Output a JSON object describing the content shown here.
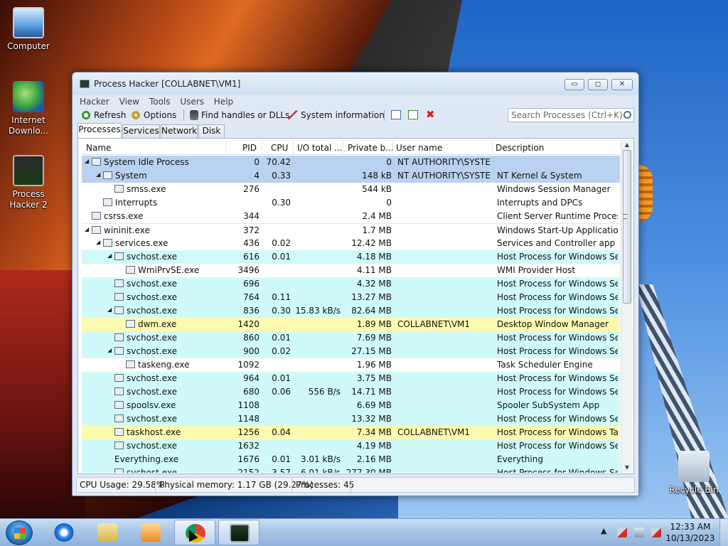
{
  "desktop": {
    "icons": [
      {
        "label": "Computer"
      },
      {
        "label": "Internet Downlo..."
      },
      {
        "label": "Process Hacker 2"
      },
      {
        "label": "Recycle Bin"
      }
    ]
  },
  "window": {
    "title": "Process Hacker [COLLABNET\\VM1]",
    "controls": {
      "minimize": "▭",
      "maximize": "◻",
      "close": "✕"
    },
    "menu": [
      "Hacker",
      "View",
      "Tools",
      "Users",
      "Help"
    ],
    "toolbar": {
      "refresh": "Refresh",
      "options": "Options",
      "find_handles": "Find handles or DLLs",
      "system_information": "System information",
      "search_placeholder": "Search Processes (Ctrl+K)"
    },
    "tabs": [
      "Processes",
      "Services",
      "Network",
      "Disk"
    ],
    "columns": [
      "Name",
      "PID",
      "CPU",
      "I/O total ...",
      "Private b...",
      "User name",
      "Description"
    ],
    "rows": [
      {
        "name": "System Idle Process",
        "pid": "0",
        "cpu": "70.42",
        "io": "",
        "priv": "0",
        "user": "NT AUTHORITY\\SYSTEM",
        "desc": "",
        "indent": 0,
        "expand": true,
        "kind": "sel"
      },
      {
        "name": "System",
        "pid": "4",
        "cpu": "0.33",
        "io": "",
        "priv": "148 kB",
        "user": "NT AUTHORITY\\SYSTEM",
        "desc": "NT Kernel & System",
        "indent": 1,
        "expand": true,
        "kind": "sel"
      },
      {
        "name": "smss.exe",
        "pid": "276",
        "cpu": "",
        "io": "",
        "priv": "544 kB",
        "user": "",
        "desc": "Windows Session Manager",
        "indent": 2,
        "expand": false,
        "kind": "plain"
      },
      {
        "name": "Interrupts",
        "pid": "",
        "cpu": "0.30",
        "io": "",
        "priv": "0",
        "user": "",
        "desc": "Interrupts and DPCs",
        "indent": 1,
        "expand": false,
        "kind": "plain"
      },
      {
        "name": "csrss.exe",
        "pid": "344",
        "cpu": "",
        "io": "",
        "priv": "2.4 MB",
        "user": "",
        "desc": "Client Server Runtime Process",
        "indent": 0,
        "expand": false,
        "kind": "plain"
      },
      {
        "name": "wininit.exe",
        "pid": "372",
        "cpu": "",
        "io": "",
        "priv": "1.7 MB",
        "user": "",
        "desc": "Windows Start-Up Application",
        "indent": 0,
        "expand": true,
        "kind": "hot"
      },
      {
        "name": "services.exe",
        "pid": "436",
        "cpu": "0.02",
        "io": "",
        "priv": "12.42 MB",
        "user": "",
        "desc": "Services and Controller app",
        "indent": 1,
        "expand": true,
        "kind": "plain"
      },
      {
        "name": "svchost.exe",
        "pid": "616",
        "cpu": "0.01",
        "io": "",
        "priv": "4.18 MB",
        "user": "",
        "desc": "Host Process for Windows Ser...",
        "indent": 2,
        "expand": true,
        "kind": "svc"
      },
      {
        "name": "WmiPrvSE.exe",
        "pid": "3496",
        "cpu": "",
        "io": "",
        "priv": "4.11 MB",
        "user": "",
        "desc": "WMI Provider Host",
        "indent": 3,
        "expand": false,
        "kind": "plain"
      },
      {
        "name": "svchost.exe",
        "pid": "696",
        "cpu": "",
        "io": "",
        "priv": "4.32 MB",
        "user": "",
        "desc": "Host Process for Windows Ser...",
        "indent": 2,
        "expand": false,
        "kind": "svc"
      },
      {
        "name": "svchost.exe",
        "pid": "764",
        "cpu": "0.11",
        "io": "",
        "priv": "13.27 MB",
        "user": "",
        "desc": "Host Process for Windows Ser...",
        "indent": 2,
        "expand": false,
        "kind": "svc"
      },
      {
        "name": "svchost.exe",
        "pid": "836",
        "cpu": "0.30",
        "io": "15.83 kB/s",
        "priv": "82.64 MB",
        "user": "",
        "desc": "Host Process for Windows Ser...",
        "indent": 2,
        "expand": true,
        "kind": "svc"
      },
      {
        "name": "dwm.exe",
        "pid": "1420",
        "cpu": "",
        "io": "",
        "priv": "1.89 MB",
        "user": "COLLABNET\\VM1",
        "desc": "Desktop Window Manager",
        "indent": 3,
        "expand": false,
        "kind": "own"
      },
      {
        "name": "svchost.exe",
        "pid": "860",
        "cpu": "0.01",
        "io": "",
        "priv": "7.69 MB",
        "user": "",
        "desc": "Host Process for Windows Ser...",
        "indent": 2,
        "expand": false,
        "kind": "svc"
      },
      {
        "name": "svchost.exe",
        "pid": "900",
        "cpu": "0.02",
        "io": "",
        "priv": "27.15 MB",
        "user": "",
        "desc": "Host Process for Windows Ser...",
        "indent": 2,
        "expand": true,
        "kind": "svc"
      },
      {
        "name": "taskeng.exe",
        "pid": "1092",
        "cpu": "",
        "io": "",
        "priv": "1.96 MB",
        "user": "",
        "desc": "Task Scheduler Engine",
        "indent": 3,
        "expand": false,
        "kind": "plain"
      },
      {
        "name": "svchost.exe",
        "pid": "964",
        "cpu": "0.01",
        "io": "",
        "priv": "3.75 MB",
        "user": "",
        "desc": "Host Process for Windows Ser...",
        "indent": 2,
        "expand": false,
        "kind": "svc"
      },
      {
        "name": "svchost.exe",
        "pid": "680",
        "cpu": "0.06",
        "io": "556 B/s",
        "priv": "14.71 MB",
        "user": "",
        "desc": "Host Process for Windows Ser...",
        "indent": 2,
        "expand": false,
        "kind": "svc"
      },
      {
        "name": "spoolsv.exe",
        "pid": "1108",
        "cpu": "",
        "io": "",
        "priv": "6.69 MB",
        "user": "",
        "desc": "Spooler SubSystem App",
        "indent": 2,
        "expand": false,
        "kind": "svc"
      },
      {
        "name": "svchost.exe",
        "pid": "1148",
        "cpu": "",
        "io": "",
        "priv": "13.32 MB",
        "user": "",
        "desc": "Host Process for Windows Ser...",
        "indent": 2,
        "expand": false,
        "kind": "svc"
      },
      {
        "name": "taskhost.exe",
        "pid": "1256",
        "cpu": "0.04",
        "io": "",
        "priv": "7.34 MB",
        "user": "COLLABNET\\VM1",
        "desc": "Host Process for Windows Tas...",
        "indent": 2,
        "expand": false,
        "kind": "own"
      },
      {
        "name": "svchost.exe",
        "pid": "1632",
        "cpu": "",
        "io": "",
        "priv": "4.19 MB",
        "user": "",
        "desc": "Host Process for Windows Ser...",
        "indent": 2,
        "expand": false,
        "kind": "svc"
      },
      {
        "name": "Everything.exe",
        "pid": "1676",
        "cpu": "0.01",
        "io": "3.01 kB/s",
        "priv": "2.16 MB",
        "user": "",
        "desc": "Everything",
        "indent": 2,
        "expand": false,
        "kind": "svc",
        "icon": "search"
      },
      {
        "name": "svchost.exe",
        "pid": "2152",
        "cpu": "3.57",
        "io": "6.01 kB/s",
        "priv": "277.30 MB",
        "user": "",
        "desc": "Host Process for Windows Ser...",
        "indent": 2,
        "expand": false,
        "kind": "svc"
      }
    ],
    "status": {
      "cpu": "CPU Usage: 29.58%",
      "memory": "Physical memory: 1.17 GB (29.27%)",
      "processes": "Processes: 45"
    }
  },
  "taskbar": {
    "apps": [
      "internet-explorer",
      "file-explorer",
      "media-player",
      "chrome",
      "process-hacker"
    ],
    "clock_time": "12:33 AM",
    "clock_date": "10/13/2023"
  }
}
